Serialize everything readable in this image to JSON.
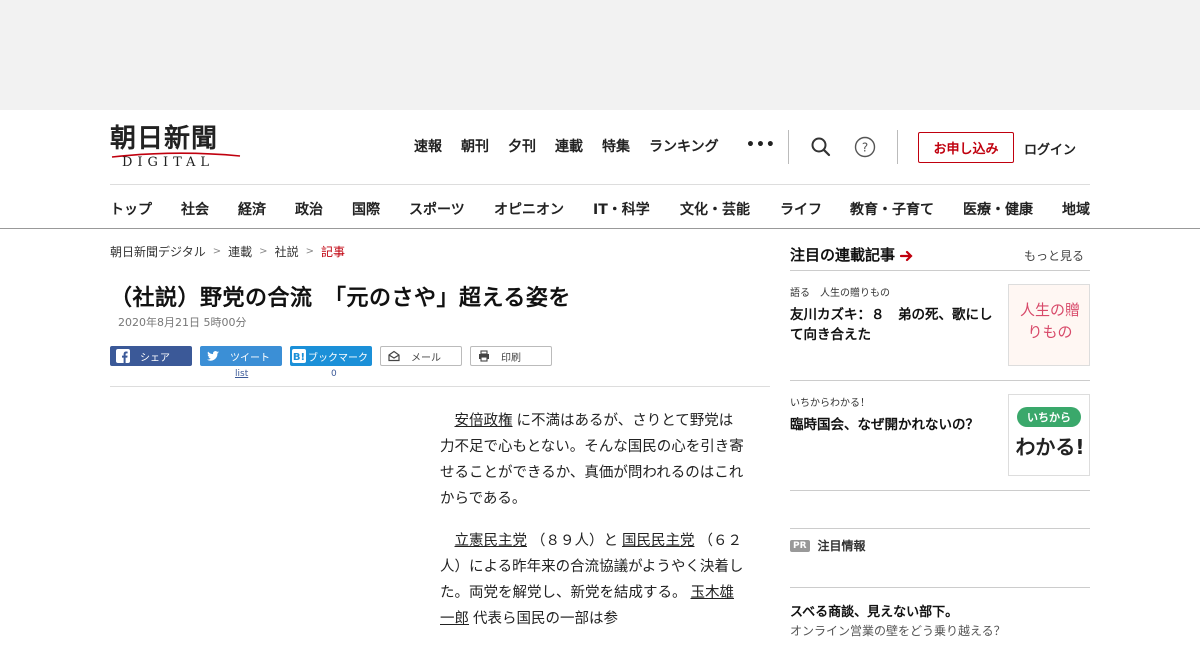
{
  "site": {
    "logo_text": "朝日新聞",
    "logo_sub": "DIGITAL"
  },
  "topnav": [
    "速報",
    "朝刊",
    "夕刊",
    "連載",
    "特集",
    "ランキング"
  ],
  "header": {
    "more": "•••",
    "search_icon": "search-icon",
    "help_icon": "help-icon",
    "signup_label": "お申し込み",
    "login_label": "ログイン",
    "accent_color": "#c0000e"
  },
  "categories": [
    "トップ",
    "社会",
    "経済",
    "政治",
    "国際",
    "スポーツ",
    "オピニオン",
    "IT・科学",
    "文化・芸能",
    "ライフ",
    "教育・子育て",
    "医療・健康",
    "地域"
  ],
  "breadcrumb": [
    "朝日新聞デジタル",
    "連載",
    "社説",
    "記事"
  ],
  "article": {
    "title": "（社説）野党の合流　「元のさや」超える姿を",
    "date": "2020年8月21日 5時00分",
    "share": {
      "facebook": "シェア",
      "twitter": "ツイート",
      "twitter_count": "list",
      "hatena": "ブックマーク",
      "hatena_count": "0",
      "mail": "メール",
      "print": "印刷"
    },
    "para1_link": "安倍政権",
    "para1_text": "に不満はあるが、さりとて野党は力不足で心もとない。そんな国民の心を引き寄せることができるか、真価が問われるのはこれからである。",
    "para2_link1": "立憲民主党",
    "para2_text1": "（８９人）と",
    "para2_link2": "国民民主党",
    "para2_text2": "（６２人）による昨年来の合流協議がようやく決着した。両党を解党し、新党を結成する。",
    "para2_link3": "玉木雄一郎",
    "para2_text3": "代表ら国民の一部は参"
  },
  "sidebar": {
    "heading": "注目の連載記事",
    "more": "もっと見る",
    "items": [
      {
        "kicker": "語る　人生の贈りもの",
        "headline": "友川カズキ：８　弟の死、歌にして向き合えた",
        "thumb_text": "人生の贈りもの"
      },
      {
        "kicker": "いちからわかる！",
        "headline": "臨時国会、なぜ開かれないの？",
        "thumb_text_top": "いちから",
        "thumb_text_bottom": "わかる!"
      }
    ],
    "pr_badge": "PR",
    "pr_label": "注目情報",
    "pr_title": "スベる商談、見えない部下。",
    "pr_sub": "オンライン営業の壁をどう乗り越える？"
  }
}
